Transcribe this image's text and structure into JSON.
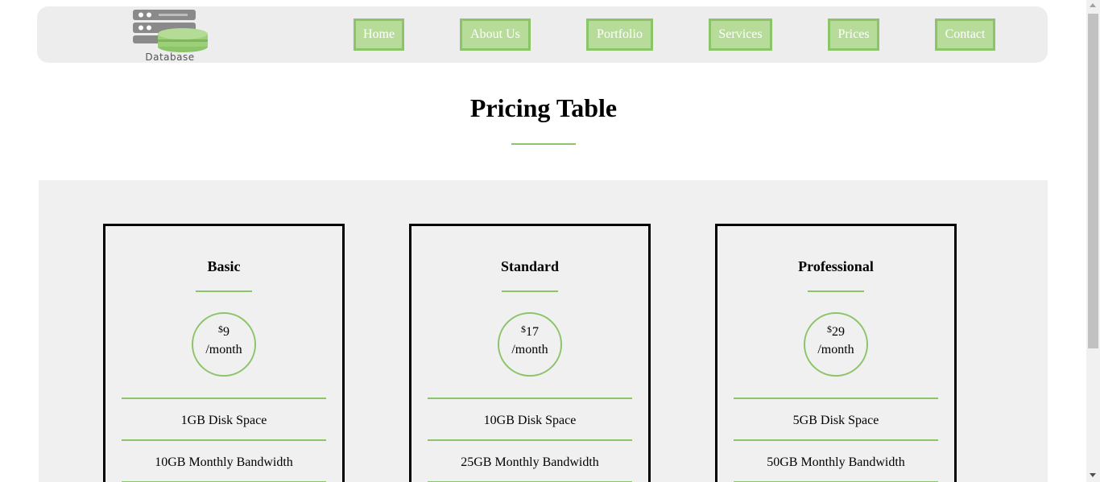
{
  "header": {
    "logo_text": "Database",
    "nav": [
      {
        "label": "Home"
      },
      {
        "label": "About Us"
      },
      {
        "label": "Portfolio"
      },
      {
        "label": "Services"
      },
      {
        "label": "Prices"
      },
      {
        "label": "Contact"
      }
    ]
  },
  "section": {
    "title": "Pricing Table"
  },
  "plans": [
    {
      "name": "Basic",
      "currency": "$",
      "price": "9",
      "period": "/month",
      "features": [
        "1GB Disk Space",
        "10GB Monthly Bandwidth"
      ]
    },
    {
      "name": "Standard",
      "currency": "$",
      "price": "17",
      "period": "/month",
      "features": [
        "10GB Disk Space",
        "25GB Monthly Bandwidth"
      ]
    },
    {
      "name": "Professional",
      "currency": "$",
      "price": "29",
      "period": "/month",
      "features": [
        "5GB Disk Space",
        "50GB Monthly Bandwidth"
      ]
    }
  ],
  "colors": {
    "accent": "#8cc46a",
    "nav_button_fill": "#b7dc9a",
    "header_bg": "#ededed",
    "pricing_bg": "#f0f0f0"
  },
  "icons": {
    "logo": "database-server-icon"
  }
}
